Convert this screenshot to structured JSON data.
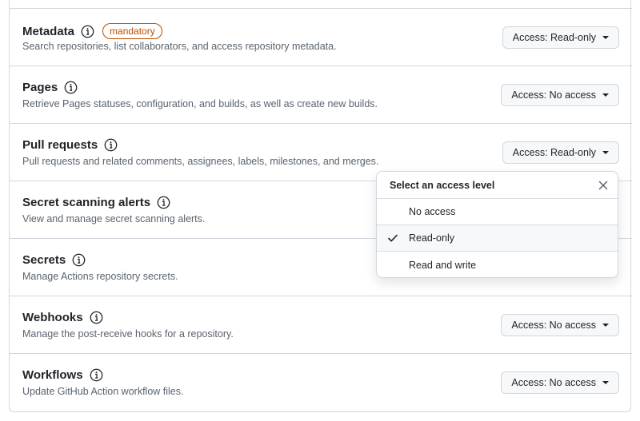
{
  "permissions": [
    {
      "title": "Metadata",
      "badge": "mandatory",
      "description": "Search repositories, list collaborators, and access repository metadata.",
      "access": "Access: Read-only"
    },
    {
      "title": "Pages",
      "badge": null,
      "description": "Retrieve Pages statuses, configuration, and builds, as well as create new builds.",
      "access": "Access: No access"
    },
    {
      "title": "Pull requests",
      "badge": null,
      "description": "Pull requests and related comments, assignees, labels, milestones, and merges.",
      "access": "Access: Read-only"
    },
    {
      "title": "Secret scanning alerts",
      "badge": null,
      "description": "View and manage secret scanning alerts.",
      "access": ""
    },
    {
      "title": "Secrets",
      "badge": null,
      "description": "Manage Actions repository secrets.",
      "access": ""
    },
    {
      "title": "Webhooks",
      "badge": null,
      "description": "Manage the post-receive hooks for a repository.",
      "access": "Access: No access"
    },
    {
      "title": "Workflows",
      "badge": null,
      "description": "Update GitHub Action workflow files.",
      "access": "Access: No access"
    }
  ],
  "dropdown": {
    "title": "Select an access level",
    "options": [
      {
        "label": "No access",
        "selected": false
      },
      {
        "label": "Read-only",
        "selected": true
      },
      {
        "label": "Read and write",
        "selected": false
      }
    ]
  },
  "colors": {
    "badge": "#bc4c00",
    "border": "#d0d7de",
    "muted_text": "#59636e",
    "button_bg": "#f6f8fa"
  }
}
